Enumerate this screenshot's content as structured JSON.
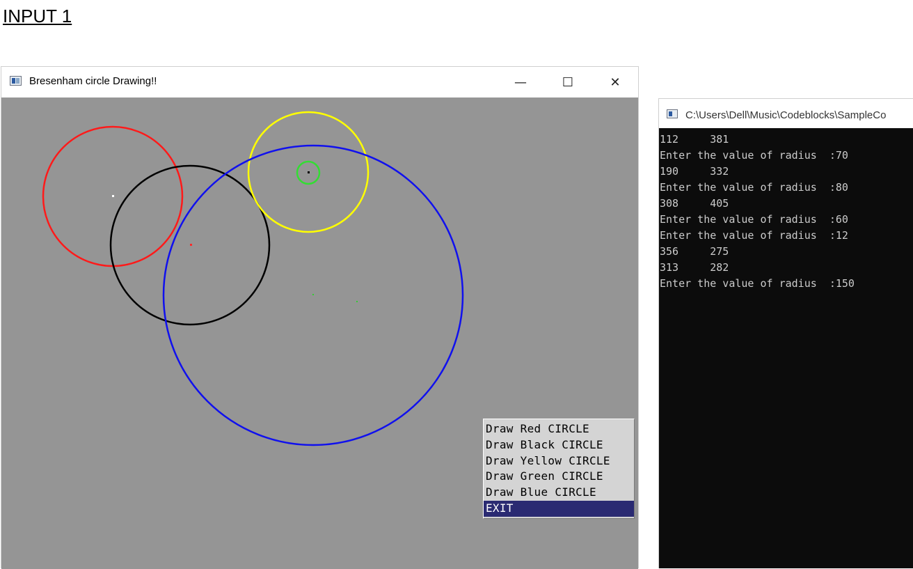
{
  "heading": "INPUT 1",
  "glut_window": {
    "title": "Bresenham circle Drawing!!",
    "controls": {
      "minimize": "—",
      "maximize": "☐",
      "close": "✕"
    },
    "background_color": "#959595",
    "circles": [
      {
        "name": "red-circle",
        "color": "#ff1a1a"
      },
      {
        "name": "black-circle",
        "color": "#000000"
      },
      {
        "name": "yellow-circle",
        "color": "#ffff00"
      },
      {
        "name": "green-circle",
        "color": "#33dd33"
      },
      {
        "name": "blue-circle",
        "color": "#1010ee"
      }
    ],
    "menu": {
      "items": [
        {
          "label": "Draw Red CIRCLE",
          "selected": false
        },
        {
          "label": "Draw Black CIRCLE",
          "selected": false
        },
        {
          "label": "Draw Yellow CIRCLE",
          "selected": false
        },
        {
          "label": "Draw Green CIRCLE",
          "selected": false
        },
        {
          "label": "Draw Blue CIRCLE",
          "selected": false
        },
        {
          "label": "EXIT",
          "selected": true
        }
      ],
      "selected_color": "#2a2a72"
    }
  },
  "console_window": {
    "title": "C:\\Users\\Dell\\Music\\Codeblocks\\SampleCo",
    "lines": [
      "112     381",
      "Enter the value of radius  :70",
      "190     332",
      "Enter the value of radius  :80",
      "308     405",
      "Enter the value of radius  :60",
      "Enter the value of radius  :12",
      "356     275",
      "313     282",
      "Enter the value of radius  :150"
    ]
  }
}
